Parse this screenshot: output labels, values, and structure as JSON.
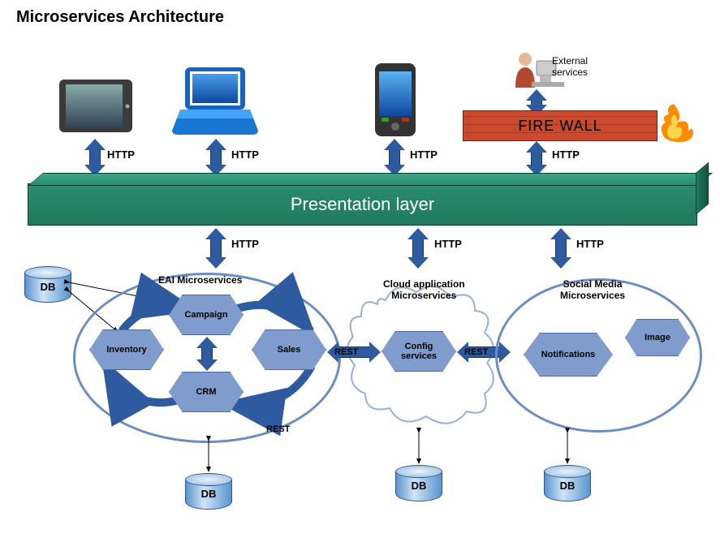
{
  "title": "Microservices Architecture",
  "external_services": "External\nservices",
  "firewall": "FIRE WALL",
  "presentation_layer": "Presentation layer",
  "protocols": {
    "http1": "HTTP",
    "http2": "HTTP",
    "http3": "HTTP",
    "http4": "HTTP",
    "http5": "HTTP",
    "http6": "HTTP",
    "http7": "HTTP",
    "rest1": "REST",
    "rest2": "REST",
    "rest3": "REST"
  },
  "groups": {
    "eai": "EAI Microservices",
    "cloud": "Cloud application\nMicroservices",
    "social": "Social Media\nMicroservices"
  },
  "services": {
    "inventory": "Inventory",
    "campaign": "Campaign",
    "crm": "CRM",
    "sales": "Sales",
    "config": "Config\nservices",
    "notifications": "Notifications",
    "image": "Image"
  },
  "db": {
    "db1": "DB",
    "db2": "DB",
    "db3": "DB",
    "db4": "DB"
  }
}
